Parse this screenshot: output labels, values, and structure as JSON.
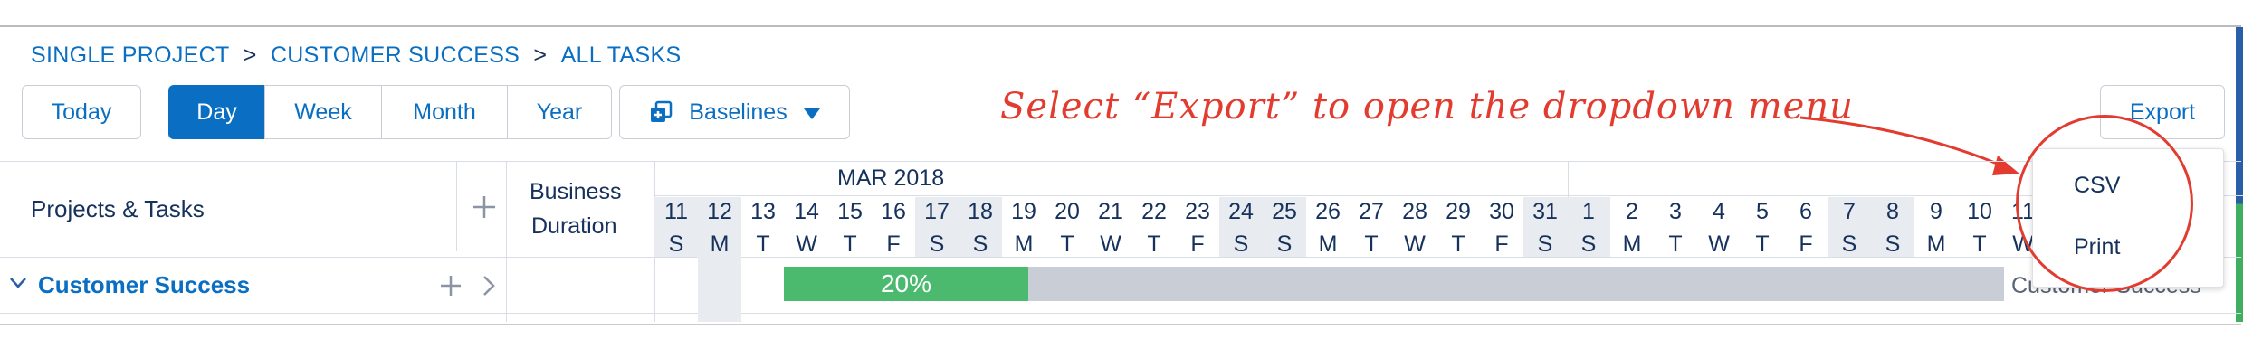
{
  "breadcrumb": {
    "items": [
      "SINGLE PROJECT",
      "CUSTOMER SUCCESS",
      "ALL TASKS"
    ],
    "separator": ">"
  },
  "toolbar": {
    "today": "Today",
    "views": [
      "Day",
      "Week",
      "Month",
      "Year"
    ],
    "active_view": "Day",
    "baselines": "Baselines",
    "export": "Export"
  },
  "annotation": "Select “Export” to open the dropdown menu",
  "grid": {
    "col_projects": "Projects & Tasks",
    "col_duration_line1": "Business",
    "col_duration_line2": "Duration",
    "month_label": "MAR 2018",
    "days": [
      {
        "d": "11",
        "w": "S"
      },
      {
        "d": "12",
        "w": "M"
      },
      {
        "d": "13",
        "w": "T"
      },
      {
        "d": "14",
        "w": "W"
      },
      {
        "d": "15",
        "w": "T"
      },
      {
        "d": "16",
        "w": "F"
      },
      {
        "d": "17",
        "w": "S"
      },
      {
        "d": "18",
        "w": "S"
      },
      {
        "d": "19",
        "w": "M"
      },
      {
        "d": "20",
        "w": "T"
      },
      {
        "d": "21",
        "w": "W"
      },
      {
        "d": "22",
        "w": "T"
      },
      {
        "d": "23",
        "w": "F"
      },
      {
        "d": "24",
        "w": "S"
      },
      {
        "d": "25",
        "w": "S"
      },
      {
        "d": "26",
        "w": "M"
      },
      {
        "d": "27",
        "w": "T"
      },
      {
        "d": "28",
        "w": "W"
      },
      {
        "d": "29",
        "w": "T"
      },
      {
        "d": "30",
        "w": "F"
      },
      {
        "d": "31",
        "w": "S"
      },
      {
        "d": "1",
        "w": "S"
      },
      {
        "d": "2",
        "w": "M"
      },
      {
        "d": "3",
        "w": "T"
      },
      {
        "d": "4",
        "w": "W"
      },
      {
        "d": "5",
        "w": "T"
      },
      {
        "d": "6",
        "w": "F"
      },
      {
        "d": "7",
        "w": "S"
      },
      {
        "d": "8",
        "w": "S"
      },
      {
        "d": "9",
        "w": "M"
      },
      {
        "d": "10",
        "w": "T"
      },
      {
        "d": "11",
        "w": "W"
      }
    ],
    "row": {
      "name": "Customer Success",
      "progress_label": "20%",
      "progress_fraction": 0.2,
      "bar_label": "Customer Success"
    }
  },
  "dropdown": {
    "items": [
      "CSV",
      "Print"
    ]
  },
  "colors": {
    "accent": "#0a6fc2",
    "annotation": "#e23b2f",
    "progress": "#4bba6e"
  }
}
